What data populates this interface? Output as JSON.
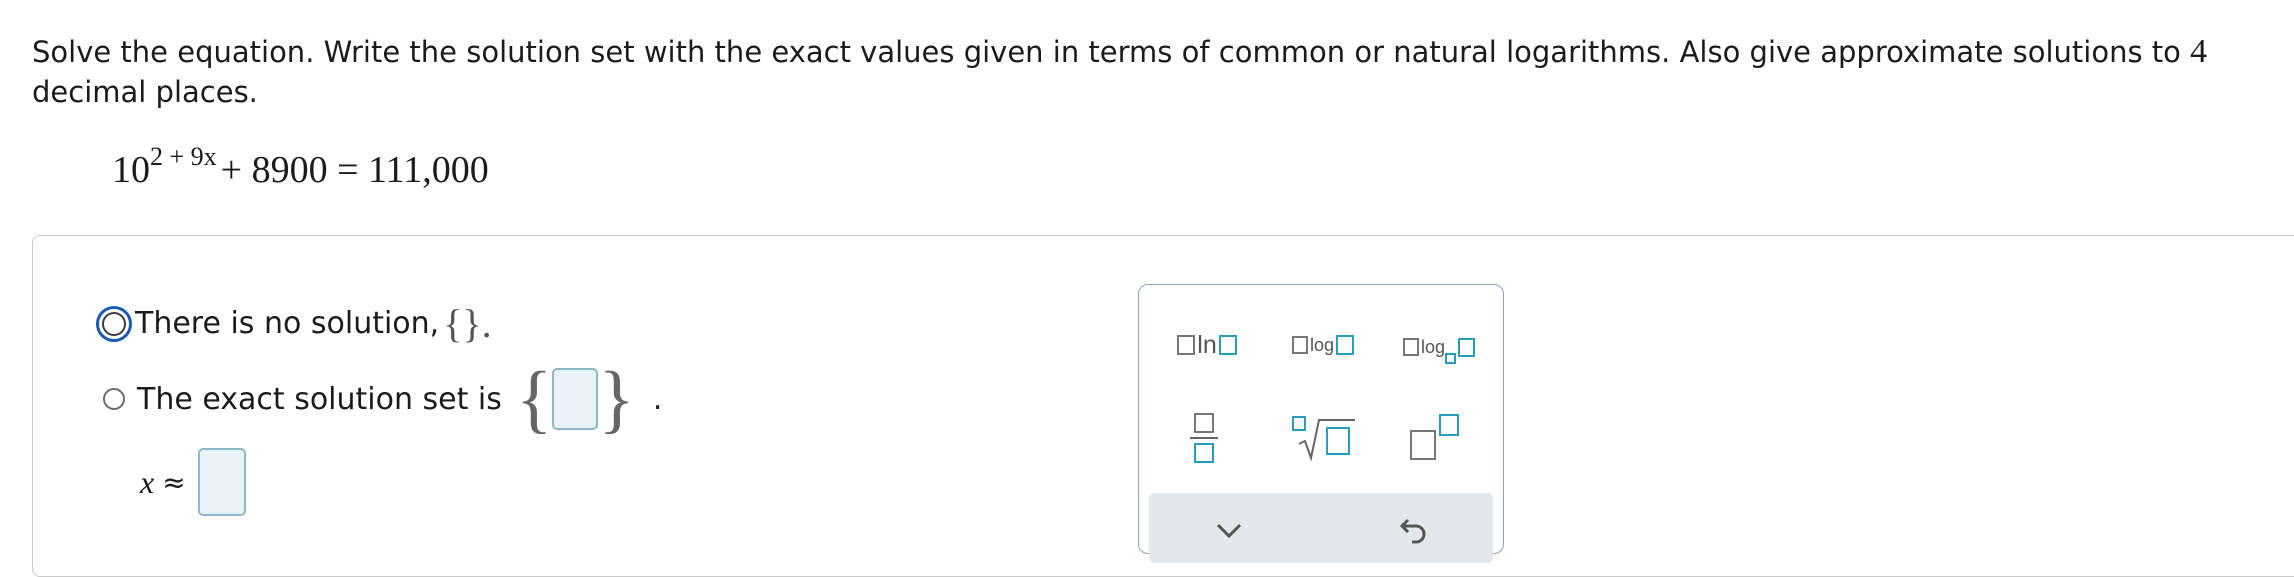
{
  "prompt": {
    "text_before": "Solve the equation. Write the solution set with the exact values given in terms of common or natural logarithms. Also give approximate solutions to ",
    "number": "4",
    "text_after": " decimal places."
  },
  "equation": {
    "base": "10",
    "exponent": "2 + 9x",
    "rest": "+ 8900 = 111,000"
  },
  "options": {
    "no_solution": "There is no solution, ",
    "no_solution_braces": "{}.",
    "exact_set": "The exact solution set is",
    "exact_period": "."
  },
  "approx": {
    "variable": "x",
    "symbol": "≈"
  },
  "palette": {
    "ln_label": "ln",
    "log_label": "log",
    "logb_label": "log"
  },
  "colors": {
    "focus": "#1a5bb4",
    "answer_box_fill": "#e7f3f8",
    "answer_box_border": "#8fb7c8",
    "palette_accent": "#2a9bc0"
  }
}
